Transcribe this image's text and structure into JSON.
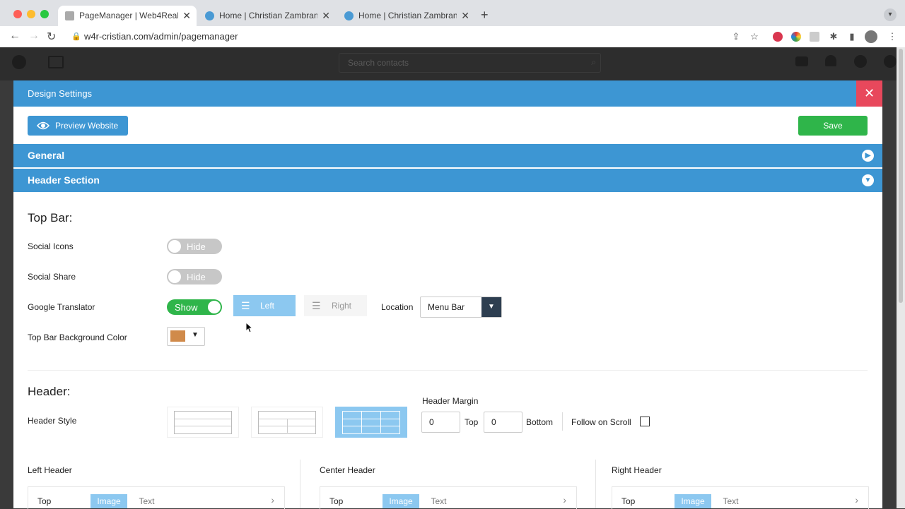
{
  "browser": {
    "tabs": [
      {
        "title": "PageManager | Web4Realty",
        "active": true
      },
      {
        "title": "Home | Christian Zambrano Re",
        "active": false
      },
      {
        "title": "Home | Christian Zambrano Re",
        "active": false
      }
    ],
    "url": "w4r-cristian.com/admin/pagemanager"
  },
  "app": {
    "search_placeholder": "Search contacts"
  },
  "modal": {
    "title": "Design Settings",
    "preview_label": "Preview Website",
    "save_label": "Save",
    "sections": {
      "general": "General",
      "header_section": "Header Section"
    },
    "top_bar": {
      "title": "Top Bar:",
      "social_icons": {
        "label": "Social Icons",
        "state": "Hide"
      },
      "social_share": {
        "label": "Social Share",
        "state": "Hide"
      },
      "google_translator": {
        "label": "Google Translator",
        "state": "Show"
      },
      "align_left": "Left",
      "align_right": "Right",
      "location_label": "Location",
      "location_value": "Menu Bar",
      "bg_color_label": "Top Bar Background Color",
      "bg_color": "#d08a4a"
    },
    "header": {
      "title": "Header:",
      "style_label": "Header Style",
      "margin_label": "Header Margin",
      "margin_top": "0",
      "top_label": "Top",
      "margin_bottom": "0",
      "bottom_label": "Bottom",
      "follow_scroll_label": "Follow on Scroll",
      "columns": [
        {
          "title": "Left Header",
          "row_label": "Top",
          "opt_image": "Image",
          "opt_text": "Text"
        },
        {
          "title": "Center Header",
          "row_label": "Top",
          "opt_image": "Image",
          "opt_text": "Text"
        },
        {
          "title": "Right Header",
          "row_label": "Top",
          "opt_image": "Image",
          "opt_text": "Text"
        }
      ]
    }
  },
  "colors": {
    "accent": "#3d96d3",
    "save": "#2fb54a",
    "close": "#e8485c",
    "toggle_on": "#2fb54a"
  }
}
